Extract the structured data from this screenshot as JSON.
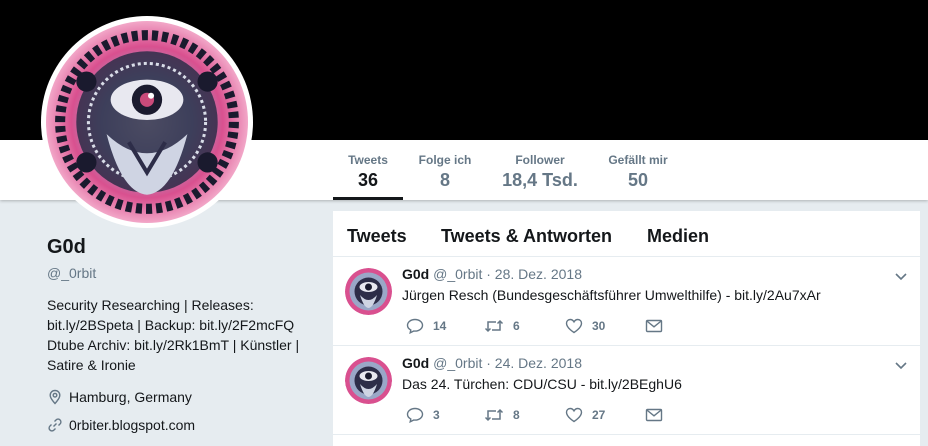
{
  "profile": {
    "name": "G0d",
    "handle": "@_0rbit",
    "bio": "Security Researching | Releases: bit.ly/2BSpeta | Backup: bit.ly/2F2mcFQ Dtube Archiv: bit.ly/2Rk1BmT | Künstler | Satire & Ironie",
    "location": "Hamburg, Germany",
    "website": "0rbiter.blogspot.com"
  },
  "nav": {
    "tweets": {
      "label": "Tweets",
      "value": "36"
    },
    "following": {
      "label": "Folge ich",
      "value": "8"
    },
    "followers": {
      "label": "Follower",
      "value": "18,4 Tsd."
    },
    "likes": {
      "label": "Gefällt mir",
      "value": "50"
    }
  },
  "tabs": {
    "tweets": "Tweets",
    "replies": "Tweets & Antworten",
    "media": "Medien"
  },
  "tweets": [
    {
      "name": "G0d",
      "handle": "@_0rbit",
      "date": "· 28. Dez. 2018",
      "text": "Jürgen Resch (Bundesgeschäftsführer Umwelthilfe) - bit.ly/2Au7xAr",
      "replies": "14",
      "retweets": "6",
      "likes": "30"
    },
    {
      "name": "G0d",
      "handle": "@_0rbit",
      "date": "· 24. Dez. 2018",
      "text": "Das 24. Türchen: CDU/CSU - bit.ly/2BEghU6",
      "replies": "3",
      "retweets": "8",
      "likes": "27"
    }
  ],
  "colors": {
    "banner": "#000000",
    "background": "#e6ecf0",
    "text_primary": "#14171a",
    "text_secondary": "#657786"
  },
  "icons": {
    "location": "location-pin-icon",
    "link": "link-icon",
    "reply": "reply-icon",
    "retweet": "retweet-icon",
    "like": "heart-icon",
    "message": "envelope-icon",
    "caret": "chevron-down-icon"
  }
}
